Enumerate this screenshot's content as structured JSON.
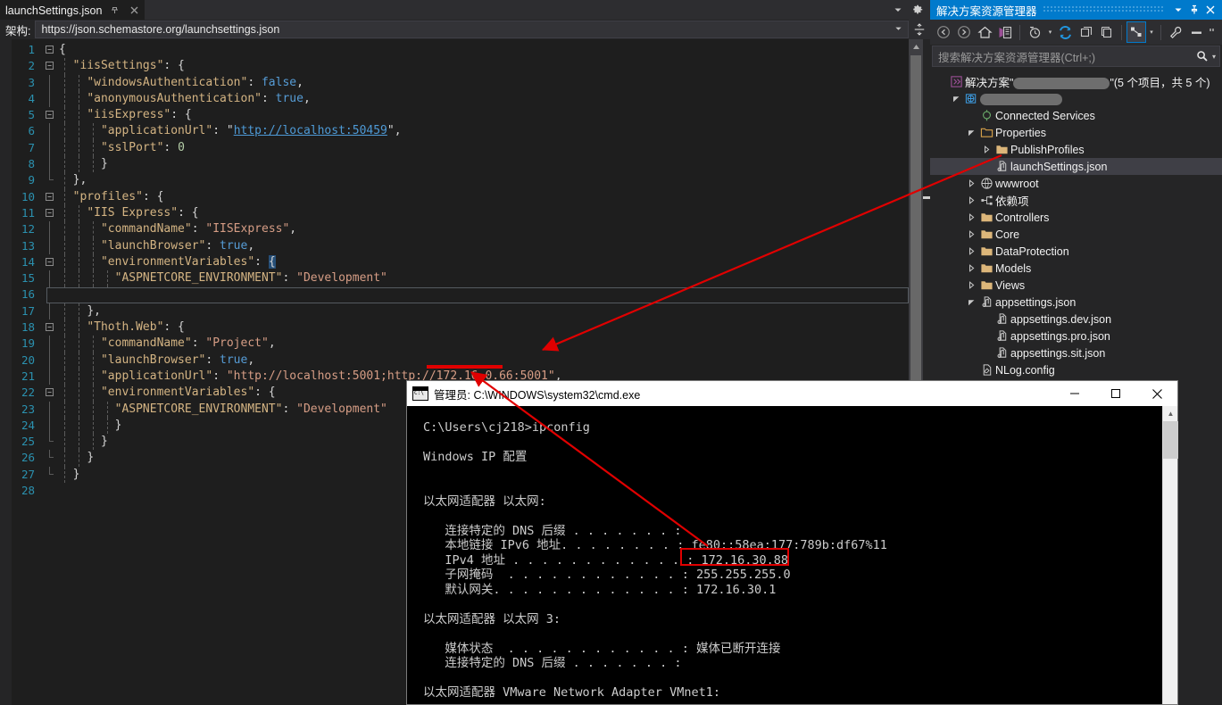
{
  "editor": {
    "tab": {
      "title": "launchSettings.json",
      "pin_icon": "pin-icon",
      "close_icon": "close-icon"
    },
    "tabstrip_right": {
      "dropdown_icon": "chevron-down-icon",
      "settings_icon": "gear-icon"
    },
    "schema_bar": {
      "label": "架构:",
      "value": "https://json.schemastore.org/launchsettings.json",
      "dropdown_icon": "chevron-down-icon",
      "split_icon": "split-window-icon"
    },
    "line_count": 28,
    "lines": [
      {
        "n": 1,
        "fold": "minus",
        "indent": 0,
        "tokens": [
          {
            "t": "{",
            "c": "p"
          }
        ]
      },
      {
        "n": 2,
        "fold": "minus",
        "indent": 1,
        "tokens": [
          {
            "t": "\"iisSettings\"",
            "c": "k"
          },
          {
            "t": ": {",
            "c": "p"
          }
        ]
      },
      {
        "n": 3,
        "fold": "bar",
        "indent": 2,
        "tokens": [
          {
            "t": "\"windowsAuthentication\"",
            "c": "k"
          },
          {
            "t": ": ",
            "c": "p"
          },
          {
            "t": "false",
            "c": "b"
          },
          {
            "t": ",",
            "c": "p"
          }
        ]
      },
      {
        "n": 4,
        "fold": "bar",
        "indent": 2,
        "tokens": [
          {
            "t": "\"anonymousAuthentication\"",
            "c": "k"
          },
          {
            "t": ": ",
            "c": "p"
          },
          {
            "t": "true",
            "c": "b"
          },
          {
            "t": ",",
            "c": "p"
          }
        ]
      },
      {
        "n": 5,
        "fold": "minus",
        "indent": 2,
        "tokens": [
          {
            "t": "\"iisExpress\"",
            "c": "k"
          },
          {
            "t": ": {",
            "c": "p"
          }
        ]
      },
      {
        "n": 6,
        "fold": "bar",
        "indent": 3,
        "tokens": [
          {
            "t": "\"applicationUrl\"",
            "c": "k"
          },
          {
            "t": ": \"",
            "c": "p"
          },
          {
            "t": "http://localhost:50459",
            "c": "lnk"
          },
          {
            "t": "\",",
            "c": "p"
          }
        ]
      },
      {
        "n": 7,
        "fold": "bar",
        "indent": 3,
        "tokens": [
          {
            "t": "\"sslPort\"",
            "c": "k"
          },
          {
            "t": ": ",
            "c": "p"
          },
          {
            "t": "0",
            "c": "n"
          }
        ]
      },
      {
        "n": 8,
        "fold": "bar",
        "indent": 3,
        "tokens": [
          {
            "t": "}",
            "c": "p"
          }
        ]
      },
      {
        "n": 9,
        "fold": "end",
        "indent": 1,
        "tokens": [
          {
            "t": "},",
            "c": "p"
          }
        ]
      },
      {
        "n": 10,
        "fold": "minus",
        "indent": 1,
        "tokens": [
          {
            "t": "\"profiles\"",
            "c": "k"
          },
          {
            "t": ": {",
            "c": "p"
          }
        ]
      },
      {
        "n": 11,
        "fold": "minus",
        "indent": 2,
        "tokens": [
          {
            "t": "\"IIS Express\"",
            "c": "k"
          },
          {
            "t": ": {",
            "c": "p"
          }
        ]
      },
      {
        "n": 12,
        "fold": "bar",
        "indent": 3,
        "tokens": [
          {
            "t": "\"commandName\"",
            "c": "k"
          },
          {
            "t": ": ",
            "c": "p"
          },
          {
            "t": "\"IISExpress\"",
            "c": "s"
          },
          {
            "t": ",",
            "c": "p"
          }
        ]
      },
      {
        "n": 13,
        "fold": "bar",
        "indent": 3,
        "tokens": [
          {
            "t": "\"launchBrowser\"",
            "c": "k"
          },
          {
            "t": ": ",
            "c": "p"
          },
          {
            "t": "true",
            "c": "b"
          },
          {
            "t": ",",
            "c": "p"
          }
        ]
      },
      {
        "n": 14,
        "fold": "minus",
        "indent": 3,
        "tokens": [
          {
            "t": "\"environmentVariables\"",
            "c": "k"
          },
          {
            "t": ": ",
            "c": "p"
          },
          {
            "t": "{",
            "c": "match"
          }
        ]
      },
      {
        "n": 15,
        "fold": "bar",
        "indent": 4,
        "tokens": [
          {
            "t": "\"ASPNETCORE_ENVIRONMENT\"",
            "c": "k"
          },
          {
            "t": ": ",
            "c": "p"
          },
          {
            "t": "\"Development\"",
            "c": "s"
          }
        ]
      },
      {
        "n": 16,
        "fold": "bar",
        "indent": 4,
        "tokens": [
          {
            "t": "}",
            "c": "match"
          }
        ]
      },
      {
        "n": 17,
        "fold": "bar",
        "indent": 2,
        "tokens": [
          {
            "t": "},",
            "c": "p"
          }
        ]
      },
      {
        "n": 18,
        "fold": "minus",
        "indent": 2,
        "tokens": [
          {
            "t": "\"Thoth.Web\"",
            "c": "k"
          },
          {
            "t": ": {",
            "c": "p"
          }
        ]
      },
      {
        "n": 19,
        "fold": "bar",
        "indent": 3,
        "tokens": [
          {
            "t": "\"commandName\"",
            "c": "k"
          },
          {
            "t": ": ",
            "c": "p"
          },
          {
            "t": "\"Project\"",
            "c": "s"
          },
          {
            "t": ",",
            "c": "p"
          }
        ]
      },
      {
        "n": 20,
        "fold": "bar",
        "indent": 3,
        "tokens": [
          {
            "t": "\"launchBrowser\"",
            "c": "k"
          },
          {
            "t": ": ",
            "c": "p"
          },
          {
            "t": "true",
            "c": "b"
          },
          {
            "t": ",",
            "c": "p"
          }
        ]
      },
      {
        "n": 21,
        "fold": "bar",
        "indent": 3,
        "tokens": [
          {
            "t": "\"applicationUrl\"",
            "c": "k"
          },
          {
            "t": ": ",
            "c": "p"
          },
          {
            "t": "\"http://localhost:5001;http://172.16.0.66:5001\"",
            "c": "s"
          },
          {
            "t": ",",
            "c": "p"
          }
        ]
      },
      {
        "n": 22,
        "fold": "minus",
        "indent": 3,
        "tokens": [
          {
            "t": "\"environmentVariables\"",
            "c": "k"
          },
          {
            "t": ": {",
            "c": "p"
          }
        ]
      },
      {
        "n": 23,
        "fold": "bar",
        "indent": 4,
        "tokens": [
          {
            "t": "\"ASPNETCORE_ENVIRONMENT\"",
            "c": "k"
          },
          {
            "t": ": ",
            "c": "p"
          },
          {
            "t": "\"Development\"",
            "c": "s"
          }
        ]
      },
      {
        "n": 24,
        "fold": "bar",
        "indent": 4,
        "tokens": [
          {
            "t": "}",
            "c": "p"
          }
        ]
      },
      {
        "n": 25,
        "fold": "end",
        "indent": 3,
        "tokens": [
          {
            "t": "}",
            "c": "p"
          }
        ]
      },
      {
        "n": 26,
        "fold": "end",
        "indent": 2,
        "tokens": [
          {
            "t": "}",
            "c": "p"
          }
        ]
      },
      {
        "n": 27,
        "fold": "end",
        "indent": 1,
        "tokens": [
          {
            "t": "}",
            "c": "p"
          }
        ]
      },
      {
        "n": 28,
        "fold": "none",
        "indent": 0,
        "tokens": []
      }
    ]
  },
  "solution_explorer": {
    "title": "解决方案资源管理器",
    "title_buttons": [
      {
        "name": "dropdown-icon",
        "glyph": "▾"
      },
      {
        "name": "pin-icon",
        "glyph": "pin"
      },
      {
        "name": "close-icon",
        "glyph": "✕"
      }
    ],
    "toolbar": [
      {
        "name": "back-icon",
        "tip": "后退"
      },
      {
        "name": "forward-icon",
        "tip": "前进"
      },
      {
        "name": "home-icon",
        "tip": "主页"
      },
      {
        "name": "solution-root-icon",
        "tip": "返回解决方案"
      },
      {
        "name": "pending-changes-icon",
        "tip": "挂起的更改筛选器"
      },
      {
        "name": "refresh-icon",
        "tip": "刷新"
      },
      {
        "name": "collapse-all-icon",
        "tip": "全部折叠"
      },
      {
        "name": "show-all-files-icon",
        "tip": "显示所有文件"
      },
      {
        "name": "view-designer-icon",
        "tip": "查看代码/设计器",
        "active": true
      },
      {
        "name": "properties-icon",
        "tip": "属性"
      },
      {
        "name": "preview-selected-icon",
        "tip": "预览选定项"
      },
      {
        "name": "overflow-icon",
        "tip": "溢出"
      }
    ],
    "search": {
      "placeholder": "搜索解决方案资源管理器(Ctrl+;)",
      "icon": "search-icon",
      "dropdown_icon": "chevron-down-icon"
    },
    "tree": [
      {
        "depth": 0,
        "expander": "none",
        "icon": "solution-icon",
        "label_prefix": "解决方案\"",
        "redacted": true,
        "label_suffix": "\"(5 个项目，共 5 个)"
      },
      {
        "depth": 1,
        "expander": "expanded",
        "icon": "web-project-icon",
        "label_prefix": "",
        "redacted": true,
        "label_suffix": ""
      },
      {
        "depth": 2,
        "expander": "none",
        "icon": "connected-services-icon",
        "label": "Connected Services"
      },
      {
        "depth": 2,
        "expander": "expanded",
        "icon": "properties-folder-icon",
        "label": "Properties"
      },
      {
        "depth": 3,
        "expander": "collapsed",
        "icon": "folder-icon",
        "label": "PublishProfiles"
      },
      {
        "depth": 3,
        "expander": "none",
        "icon": "json-file-icon",
        "label": "launchSettings.json",
        "selected": true
      },
      {
        "depth": 2,
        "expander": "collapsed",
        "icon": "wwwroot-icon",
        "label": "wwwroot"
      },
      {
        "depth": 2,
        "expander": "collapsed",
        "icon": "dependencies-icon",
        "label": "依赖项"
      },
      {
        "depth": 2,
        "expander": "collapsed",
        "icon": "folder-icon",
        "label": "Controllers"
      },
      {
        "depth": 2,
        "expander": "collapsed",
        "icon": "folder-icon",
        "label": "Core"
      },
      {
        "depth": 2,
        "expander": "collapsed",
        "icon": "folder-icon",
        "label": "DataProtection"
      },
      {
        "depth": 2,
        "expander": "collapsed",
        "icon": "folder-icon",
        "label": "Models"
      },
      {
        "depth": 2,
        "expander": "collapsed",
        "icon": "folder-icon",
        "label": "Views"
      },
      {
        "depth": 2,
        "expander": "expanded",
        "icon": "json-file-icon",
        "label": "appsettings.json"
      },
      {
        "depth": 3,
        "expander": "none",
        "icon": "json-file-icon",
        "label": "appsettings.dev.json"
      },
      {
        "depth": 3,
        "expander": "none",
        "icon": "json-file-icon",
        "label": "appsettings.pro.json"
      },
      {
        "depth": 3,
        "expander": "none",
        "icon": "json-file-icon",
        "label": "appsettings.sit.json"
      },
      {
        "depth": 2,
        "expander": "none",
        "icon": "config-file-icon",
        "label": "NLog.config"
      }
    ]
  },
  "cmd_window": {
    "title": "管理员: C:\\WINDOWS\\system32\\cmd.exe",
    "icon": "console-icon",
    "buttons": [
      {
        "name": "minimize-button",
        "glyph": "—"
      },
      {
        "name": "maximize-button",
        "glyph": "▢"
      },
      {
        "name": "close-button",
        "glyph": "✕"
      }
    ],
    "output": "C:\\Users\\cj218>ipconfig\n\nWindows IP 配置\n\n\n以太网适配器 以太网:\n\n   连接特定的 DNS 后缀 . . . . . . . :\n   本地链接 IPv6 地址. . . . . . . . : fe80::58ea:177:789b:df67%11\n   IPv4 地址 . . . . . . . . . . . . : 172.16.30.88\n   子网掩码  . . . . . . . . . . . . : 255.255.255.0\n   默认网关. . . . . . . . . . . . . : 172.16.30.1\n\n以太网适配器 以太网 3:\n\n   媒体状态  . . . . . . . . . . . . : 媒体已断开连接\n   连接特定的 DNS 后缀 . . . . . . . :\n\n以太网适配器 VMware Network Adapter VMnet1:",
    "highlighted_value": "172.16.30.88",
    "scrollbar": {
      "up_icon": "scroll-up-icon",
      "down_icon": "scroll-down-icon"
    }
  },
  "annotations": {
    "color": "#e00000",
    "arrow1": {
      "from": "launchSettings.json tree node",
      "to": "applicationUrl line in editor"
    },
    "arrow2": {
      "from": "IPv4 地址 172.16.30.88 in console",
      "to": "172.16.0.66 in applicationUrl"
    },
    "underline": {
      "target": "172.16.0.66:5001"
    },
    "highlight_box": {
      "target": "172.16.30.88"
    }
  }
}
